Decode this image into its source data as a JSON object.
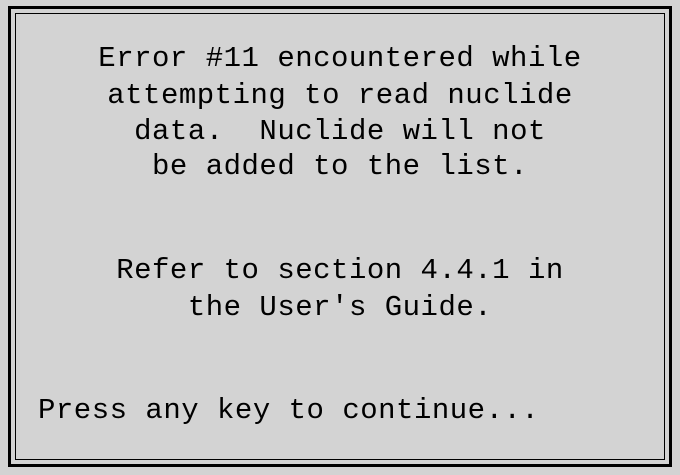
{
  "dialog": {
    "error_lines": [
      "Error #11 encountered while",
      "attempting to read nuclide",
      "data.  Nuclide will not",
      "be added to the list."
    ],
    "reference_lines": [
      "Refer to section 4.4.1 in",
      "the User's Guide."
    ],
    "prompt": "Press any key to continue..."
  }
}
